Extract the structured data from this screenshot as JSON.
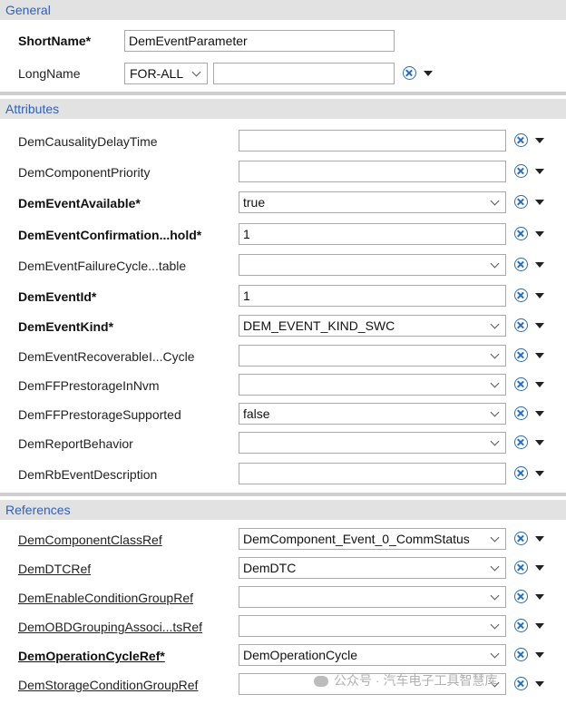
{
  "sections": {
    "general": "General",
    "attributes": "Attributes",
    "references": "References"
  },
  "general": {
    "short_name_label": "ShortName*",
    "short_name_value": "DemEventParameter",
    "long_name_label": "LongName",
    "lang_value": "FOR-ALL",
    "long_name_value": ""
  },
  "attributes": [
    {
      "label": "DemCausalityDelayTime",
      "value": ""
    },
    {
      "label": "DemComponentPriority",
      "value": ""
    },
    {
      "label": "DemEventAvailable*",
      "value": "true"
    },
    {
      "label": "DemEventConfirmation...hold*",
      "value": "1"
    },
    {
      "label": "DemEventFailureCycle...table",
      "value": ""
    },
    {
      "label": "DemEventId*",
      "value": "1"
    },
    {
      "label": "DemEventKind*",
      "value": "DEM_EVENT_KIND_SWC"
    },
    {
      "label": "DemEventRecoverableI...Cycle",
      "value": ""
    },
    {
      "label": "DemFFPrestorageInNvm",
      "value": ""
    },
    {
      "label": "DemFFPrestorageSupported",
      "value": "false"
    },
    {
      "label": "DemReportBehavior",
      "value": ""
    },
    {
      "label": "DemRbEventDescription",
      "value": ""
    }
  ],
  "references": [
    {
      "label": "DemComponentClassRef",
      "value": "DemComponent_Event_0_CommStatus"
    },
    {
      "label": "DemDTCRef",
      "value": "DemDTC"
    },
    {
      "label": "DemEnableConditionGroupRef",
      "value": ""
    },
    {
      "label": "DemOBDGroupingAssoci...tsRef",
      "value": ""
    },
    {
      "label": "DemOperationCycleRef*",
      "value": "DemOperationCycle"
    },
    {
      "label": "DemStorageConditionGroupRef",
      "value": ""
    }
  ],
  "icons": {
    "clear": "clear-x-circle-icon",
    "menu": "triangle-down-icon",
    "dropdown": "chevron-down-icon"
  },
  "colors": {
    "section_text": "#2f5fbf",
    "section_bg": "#e2e2e2",
    "icon_blue": "#2a6cb8"
  },
  "watermark": "公众号 · 汽车电子工具智慧库"
}
